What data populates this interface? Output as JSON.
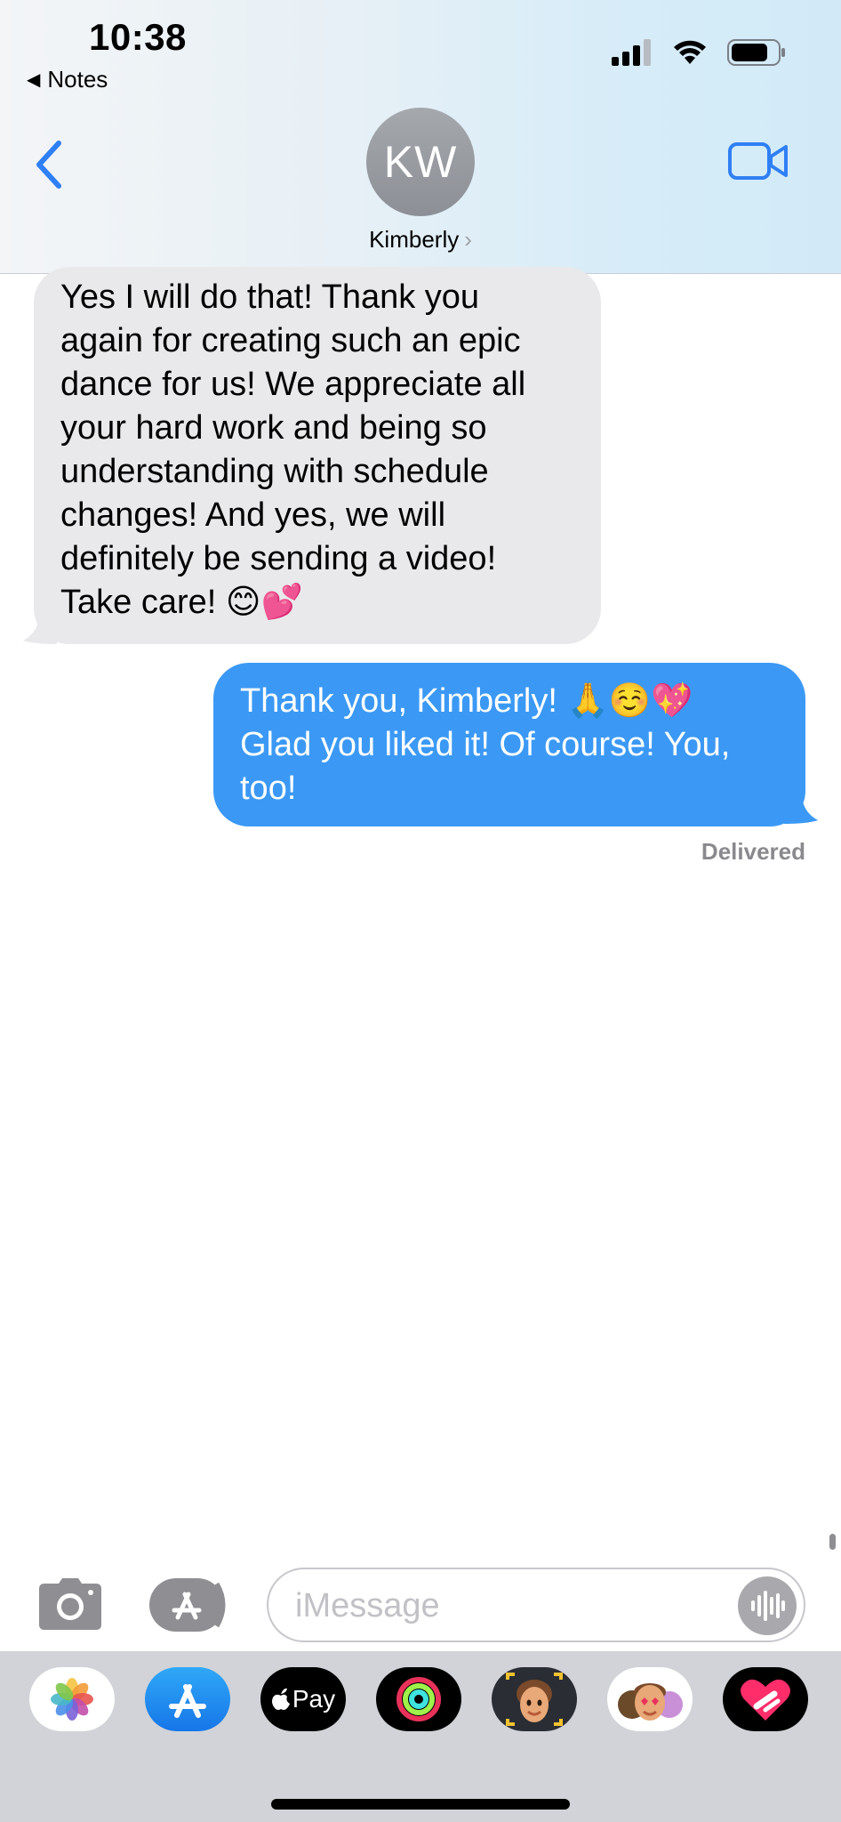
{
  "status_bar": {
    "time": "10:38",
    "back_app": "Notes",
    "icons": [
      "cellular-signal-icon",
      "wifi-icon",
      "battery-icon"
    ]
  },
  "header": {
    "avatar_initials": "KW",
    "contact_name": "Kimberly",
    "chevron": "›",
    "back_icon": "chevron-left-icon",
    "video_icon": "facetime-video-icon",
    "accent": "#2f7ff5"
  },
  "messages": [
    {
      "direction": "incoming",
      "lines": [
        "Yes I will do that! Thank you",
        "again for creating such an epic",
        "dance for us! We appreciate all",
        "your hard work and being so",
        "understanding with schedule",
        "changes! And yes, we will",
        "definitely be sending a video!",
        "Take care! 😊💕"
      ]
    },
    {
      "direction": "outgoing",
      "lines": [
        "Thank you, Kimberly! 🙏☺️💖",
        "Glad you liked it! Of course! You,",
        "too!"
      ],
      "status": "Delivered"
    }
  ],
  "composer": {
    "placeholder": "iMessage",
    "camera_icon": "camera-icon",
    "apps_icon": "app-store-icon",
    "audio_icon": "audio-waveform-icon"
  },
  "app_drawer": {
    "apps": [
      {
        "name": "photos-app-icon"
      },
      {
        "name": "app-store-app-icon"
      },
      {
        "name": "apple-pay-app-icon",
        "label": "Pay"
      },
      {
        "name": "activity-app-icon"
      },
      {
        "name": "memoji-app-icon"
      },
      {
        "name": "memoji-stickers-app-icon"
      },
      {
        "name": "digital-touch-app-icon"
      }
    ]
  },
  "colors": {
    "outgoing_bubble": "#3b99f5",
    "incoming_bubble": "#e9e9eb",
    "delivered_text": "#8a8a8e"
  }
}
